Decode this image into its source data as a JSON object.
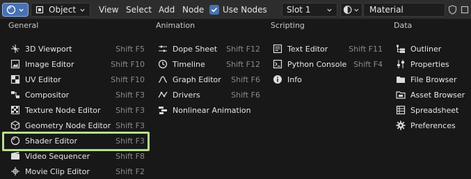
{
  "header": {
    "mode_label": "Object",
    "menus": [
      "View",
      "Select",
      "Add",
      "Node"
    ],
    "use_nodes_label": "Use Nodes",
    "slot_label": "Slot 1",
    "material_name": "Material"
  },
  "columns": [
    {
      "heading": "General",
      "items": [
        {
          "label": "3D Viewport",
          "shortcut": "Shift F5",
          "icon": "viewport-3d-icon"
        },
        {
          "label": "Image Editor",
          "shortcut": "Shift F10",
          "icon": "image-editor-icon"
        },
        {
          "label": "UV Editor",
          "shortcut": "Shift F10",
          "icon": "uv-editor-icon"
        },
        {
          "label": "Compositor",
          "shortcut": "Shift F3",
          "icon": "compositor-icon"
        },
        {
          "label": "Texture Node Editor",
          "shortcut": "Shift F3",
          "icon": "texture-node-icon"
        },
        {
          "label": "Geometry Node Editor",
          "shortcut": "Shift F3",
          "icon": "geometry-node-icon"
        },
        {
          "label": "Shader Editor",
          "shortcut": "Shift F3",
          "icon": "shader-editor-icon"
        },
        {
          "label": "Video Sequencer",
          "shortcut": "Shift F8",
          "icon": "video-sequencer-icon"
        },
        {
          "label": "Movie Clip Editor",
          "shortcut": "Shift F2",
          "icon": "movie-clip-icon"
        }
      ]
    },
    {
      "heading": "Animation",
      "items": [
        {
          "label": "Dope Sheet",
          "shortcut": "Shift F12",
          "icon": "dope-sheet-icon"
        },
        {
          "label": "Timeline",
          "shortcut": "Shift F12",
          "icon": "timeline-icon"
        },
        {
          "label": "Graph Editor",
          "shortcut": "Shift F6",
          "icon": "graph-editor-icon"
        },
        {
          "label": "Drivers",
          "shortcut": "Shift F6",
          "icon": "drivers-icon"
        },
        {
          "label": "Nonlinear Animation",
          "shortcut": "",
          "icon": "nla-icon"
        }
      ]
    },
    {
      "heading": "Scripting",
      "items": [
        {
          "label": "Text Editor",
          "shortcut": "Shift F11",
          "icon": "text-editor-icon"
        },
        {
          "label": "Python Console",
          "shortcut": "Shift F4",
          "icon": "python-console-icon"
        },
        {
          "label": "Info",
          "shortcut": "",
          "icon": "info-icon"
        }
      ]
    },
    {
      "heading": "Data",
      "items": [
        {
          "label": "Outliner",
          "shortcut": "",
          "icon": "outliner-icon"
        },
        {
          "label": "Properties",
          "shortcut": "",
          "icon": "properties-icon"
        },
        {
          "label": "File Browser",
          "shortcut": "",
          "icon": "file-browser-icon"
        },
        {
          "label": "Asset Browser",
          "shortcut": "",
          "icon": "asset-browser-icon"
        },
        {
          "label": "Spreadsheet",
          "shortcut": "",
          "icon": "spreadsheet-icon"
        },
        {
          "label": "Preferences",
          "shortcut": "",
          "icon": "preferences-icon"
        }
      ]
    }
  ],
  "colors": {
    "accent": "#4772b3",
    "highlight": "#b5e08e",
    "background": "#181818"
  }
}
